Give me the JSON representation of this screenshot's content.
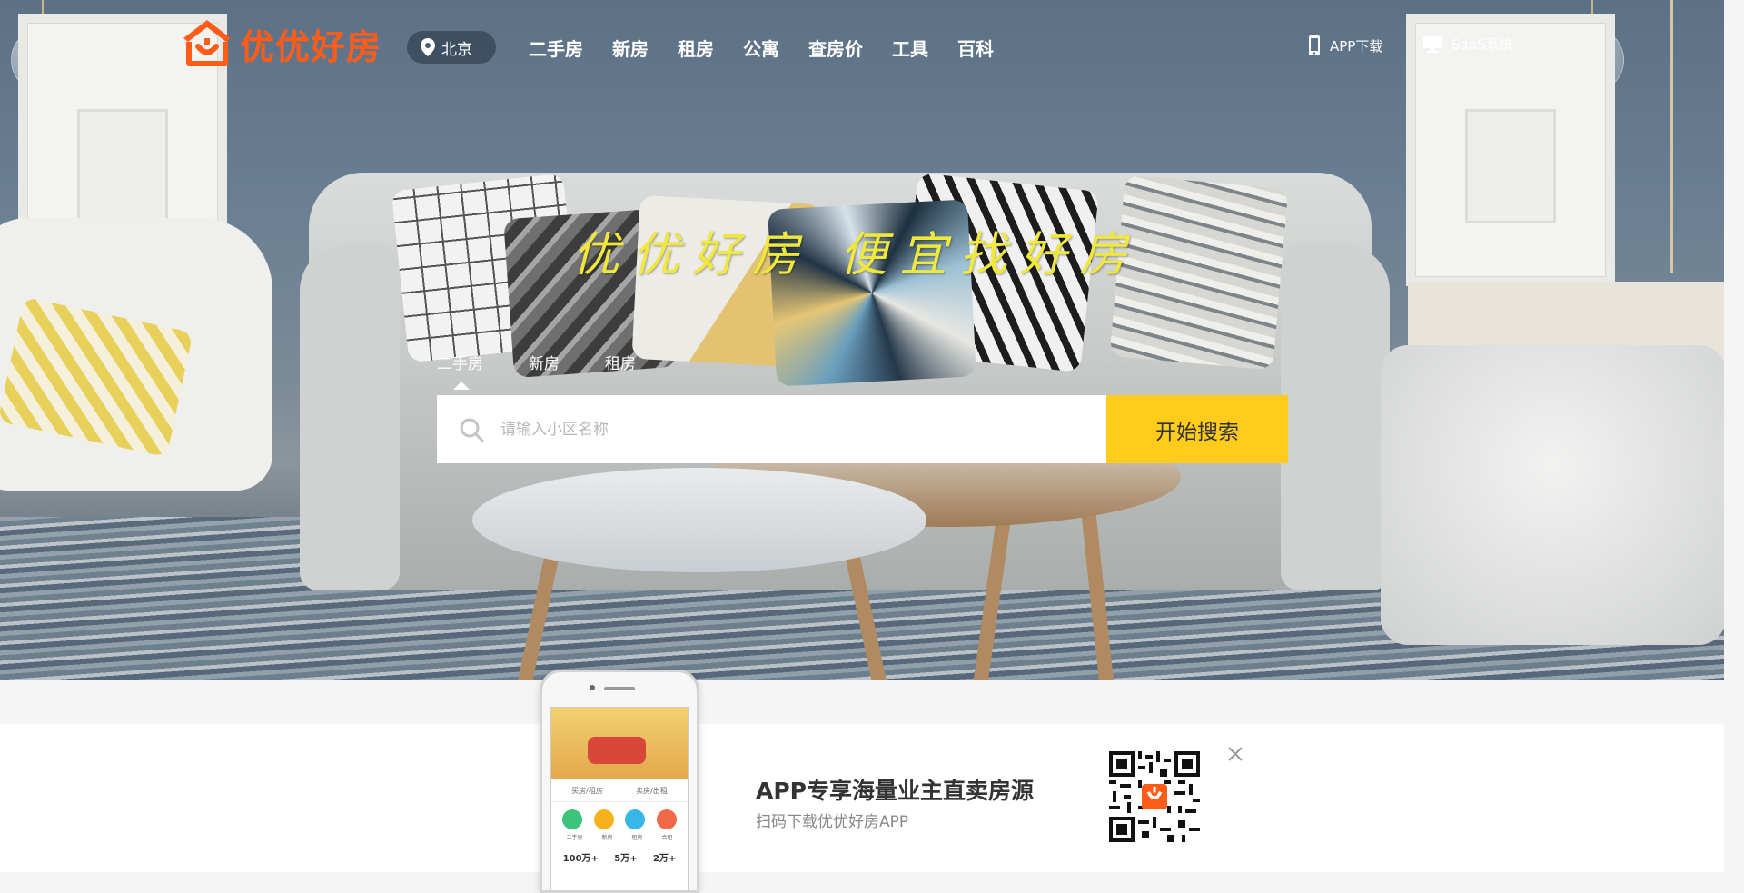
{
  "brand": {
    "name": "优优好房",
    "color": "#ff5c1a"
  },
  "city": {
    "name": "北京"
  },
  "nav": {
    "items": [
      "二手房",
      "新房",
      "租房",
      "公寓",
      "查房价",
      "工具",
      "百科"
    ]
  },
  "top_links": {
    "app": "APP下载",
    "saas": "SaaS系统"
  },
  "hero": {
    "slogan": "优优好房 便宜找好房"
  },
  "search": {
    "tabs": [
      "二手房",
      "新房",
      "租房"
    ],
    "active_tab": "二手房",
    "placeholder": "请输入小区名称",
    "button": "开始搜索",
    "button_color": "#ffcc1c"
  },
  "promo": {
    "title": "APP专享海量业主直卖房源",
    "subtitle": "扫码下载优优好房APP",
    "phone": {
      "tabs": [
        "买房/租房",
        "卖房/出租"
      ],
      "icons": [
        "二手房",
        "新房",
        "租房",
        "合租"
      ],
      "stats": [
        "100万+",
        "5万+",
        "2万+"
      ]
    }
  },
  "icons": {
    "logo": "house-smile-logo-icon",
    "city": "location-pin-icon",
    "app": "mobile-phone-icon",
    "saas": "monitor-icon",
    "search": "search-icon",
    "qr": "qr-code-icon",
    "close": "close-icon"
  }
}
